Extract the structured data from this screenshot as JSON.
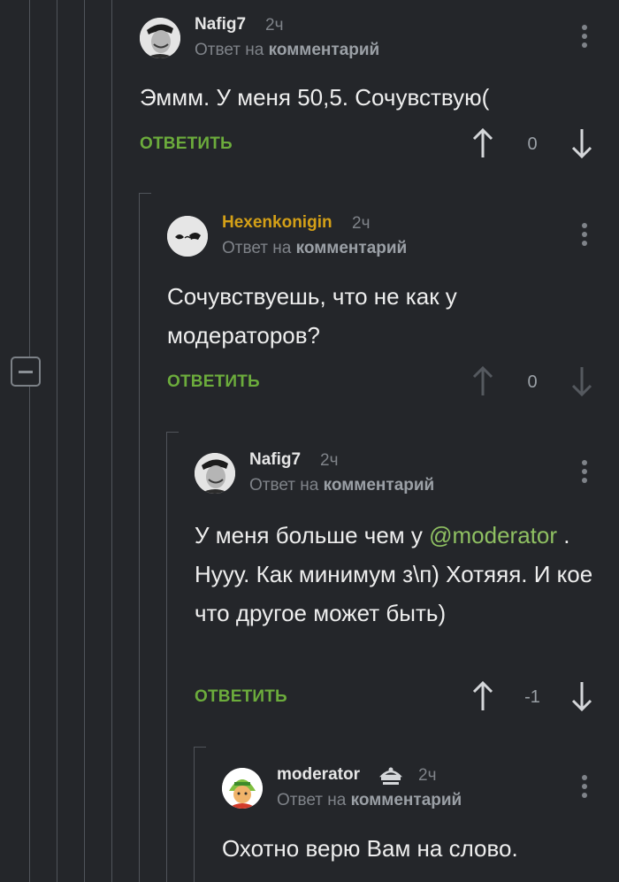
{
  "comments": [
    {
      "author": "Nafig7",
      "author_color": "#e6e6e6",
      "time": "2ч",
      "reply_prefix": "Ответ на",
      "reply_target": "комментарий",
      "text_parts": [
        "Эммм. У меня 50,5. Сочувствую("
      ],
      "reply_label": "ОТВЕТИТЬ",
      "rating": "0"
    },
    {
      "author": "Hexenkonigin",
      "author_color": "#d4a017",
      "time": "2ч",
      "reply_prefix": "Ответ на",
      "reply_target": "комментарий",
      "text_parts": [
        "Сочувствуешь, что не как у модераторов?"
      ],
      "reply_label": "ОТВЕТИТЬ",
      "rating": "0"
    },
    {
      "author": "Nafig7",
      "author_color": "#e6e6e6",
      "time": "2ч",
      "reply_prefix": "Ответ на",
      "reply_target": "комментарий",
      "text_before": "У меня больше чем у",
      "mention": "@moderator",
      "text_after": ". Нууу. Как минимум з\\п) Хотяяя. И кое что другое может быть)",
      "reply_label": "ОТВЕТИТЬ",
      "rating": "-1"
    },
    {
      "author": "moderator",
      "author_color": "#e6e6e6",
      "time": "2ч",
      "reply_prefix": "Ответ на",
      "reply_target": "комментарий",
      "text_parts": [
        "Охотно верю Вам на слово."
      ]
    }
  ],
  "icons": {
    "collapse": "minus-square-icon",
    "more": "more-vertical-icon",
    "upvote": "arrow-up-icon",
    "downvote": "arrow-down-icon",
    "moderator_badge": "moderator-cap-icon"
  },
  "colors": {
    "background": "#24262a",
    "action_green": "#6cac3c",
    "mention_green": "#8fc062",
    "username_gold": "#d4a017",
    "muted": "#7f8389"
  }
}
